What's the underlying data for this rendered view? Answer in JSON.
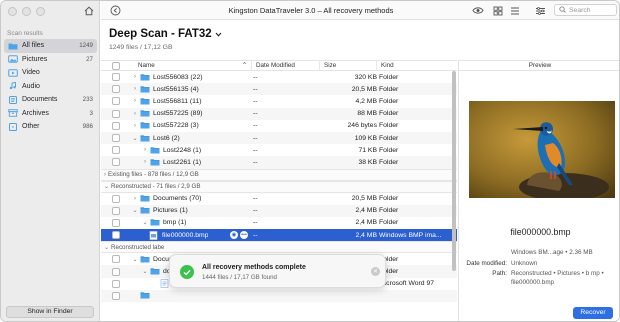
{
  "sidebar": {
    "section_label": "Scan results",
    "items": [
      {
        "label": "All files",
        "count": "1249",
        "icon": "folder-icon"
      },
      {
        "label": "Pictures",
        "count": "27",
        "icon": "picture-icon"
      },
      {
        "label": "Video",
        "count": "",
        "icon": "video-icon"
      },
      {
        "label": "Audio",
        "count": "",
        "icon": "audio-icon"
      },
      {
        "label": "Documents",
        "count": "233",
        "icon": "document-icon"
      },
      {
        "label": "Archives",
        "count": "3",
        "icon": "archive-icon"
      },
      {
        "label": "Other",
        "count": "986",
        "icon": "other-icon"
      }
    ],
    "finder_button": "Show in Finder"
  },
  "toolbar": {
    "title": "Kingston DataTraveler 3.0 – All recovery methods",
    "search_placeholder": "Search"
  },
  "main": {
    "title": "Deep Scan - FAT32",
    "subtitle": "1249 files / 17,12 GB"
  },
  "table": {
    "headers": {
      "name": "Name",
      "date": "Date Modified",
      "size": "Size",
      "kind": "Kind"
    },
    "rows_top": [
      {
        "name": "Lost556083 (22)",
        "date": "--",
        "size": "320 KB",
        "kind": "Folder",
        "indent": 1,
        "disc": "›"
      },
      {
        "name": "Lost556135 (4)",
        "date": "--",
        "size": "20,5 MB",
        "kind": "Folder",
        "indent": 1,
        "disc": "›"
      },
      {
        "name": "Lost556811 (11)",
        "date": "--",
        "size": "4,2 MB",
        "kind": "Folder",
        "indent": 1,
        "disc": "›"
      },
      {
        "name": "Lost557225 (89)",
        "date": "--",
        "size": "88 MB",
        "kind": "Folder",
        "indent": 1,
        "disc": "›"
      },
      {
        "name": "Lost557228 (3)",
        "date": "--",
        "size": "246 bytes",
        "kind": "Folder",
        "indent": 1,
        "disc": "›"
      },
      {
        "name": "Lost6 (2)",
        "date": "--",
        "size": "109 KB",
        "kind": "Folder",
        "indent": 1,
        "disc": "⌄"
      },
      {
        "name": "Lost2248 (1)",
        "date": "--",
        "size": "71 KB",
        "kind": "Folder",
        "indent": 2,
        "disc": "›"
      },
      {
        "name": "Lost2261 (1)",
        "date": "--",
        "size": "38 KB",
        "kind": "Folder",
        "indent": 2,
        "disc": "›"
      }
    ],
    "group_existing": "Existing files - 878 files / 12,9 GB",
    "group_reconstructed": "Reconstructed - 71 files / 2,9 GB",
    "rows_mid": [
      {
        "name": "Documents (70)",
        "date": "--",
        "size": "20,5 MB",
        "kind": "Folder",
        "indent": 1,
        "disc": "›"
      },
      {
        "name": "Pictures (1)",
        "date": "--",
        "size": "2,4 MB",
        "kind": "Folder",
        "indent": 1,
        "disc": "⌄"
      },
      {
        "name": "bmp (1)",
        "date": "--",
        "size": "2,4 MB",
        "kind": "Folder",
        "indent": 2,
        "disc": "⌄"
      }
    ],
    "selected_row": {
      "name": "file000000.bmp",
      "date": "--",
      "size": "2,4 MB",
      "kind": "Windows BMP ima..."
    },
    "group_labeled": "Reconstructed labe",
    "rows_bottom": [
      {
        "name": "Docum",
        "date": "",
        "size": "3,4 MB",
        "kind": "Folder",
        "indent": 1,
        "disc": "⌄"
      },
      {
        "name": "doc",
        "date": "",
        "size": "3,4 MB",
        "kind": "Folder",
        "indent": 2,
        "disc": "⌄"
      },
      {
        "name": "lu lu_000000.doc",
        "date": "14 Jun 2021, 15:29",
        "size": "26 KB",
        "kind": "Microsoft Word 97",
        "indent": 3,
        "disc": ""
      },
      {
        "name": "",
        "date": "",
        "size": "",
        "kind": "",
        "indent": 1,
        "disc": ""
      }
    ]
  },
  "toast": {
    "title": "All recovery methods complete",
    "subtitle": "1444 files / 17,17 GB found"
  },
  "preview": {
    "header": "Preview",
    "filename": "file000000.bmp",
    "kind_size": "Windows BM...age • 2.36 MB",
    "date_label": "Date modified:",
    "date_value": "Unknown",
    "path_label": "Path:",
    "path_value": "Reconstructed • Pictures • b mp • file000000.bmp",
    "recover_button": "Recover"
  },
  "colors": {
    "accent": "#2c5fd0",
    "folder": "#4fa3e6",
    "success": "#3cc14d",
    "sidebar_bg": "#ececec"
  }
}
